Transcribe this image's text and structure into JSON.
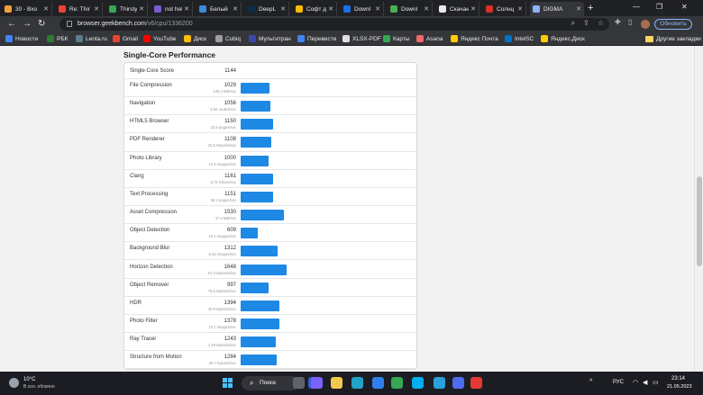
{
  "browser": {
    "tabs": [
      {
        "title": "30 - Вхо",
        "color": "#f2a03d"
      },
      {
        "title": "Re: Thir",
        "color": "#ea4335"
      },
      {
        "title": "Thirsty",
        "color": "#34a853"
      },
      {
        "title": "not hel",
        "color": "#7b5cd6"
      },
      {
        "title": "Белый",
        "color": "#3d8ad8"
      },
      {
        "title": "DeepL",
        "color": "#0f2b46"
      },
      {
        "title": "Софт д",
        "color": "#fbbc04"
      },
      {
        "title": "Downl",
        "color": "#1a73e8"
      },
      {
        "title": "Downl",
        "color": "#4caf50"
      },
      {
        "title": "Скачан",
        "color": "#e8eaed"
      },
      {
        "title": "Солнц",
        "color": "#d93025"
      },
      {
        "title": "DIGMA",
        "color": "#8ab4f8"
      }
    ],
    "url_host": "browser.geekbench.com",
    "url_path": "/v6/cpu/1336200",
    "update_label": "Обновить"
  },
  "bookmarks": [
    {
      "label": "Новости",
      "color": "#4285f4"
    },
    {
      "label": "РБК",
      "color": "#2e7d32"
    },
    {
      "label": "Lenta.ru",
      "color": "#607d8b"
    },
    {
      "label": "Gmail",
      "color": "#ea4335"
    },
    {
      "label": "YouTube",
      "color": "#ff0000"
    },
    {
      "label": "Диск",
      "color": "#fbbc04"
    },
    {
      "label": "Cubiq",
      "color": "#9e9e9e"
    },
    {
      "label": "Мультитран",
      "color": "#3949ab"
    },
    {
      "label": "Перевести",
      "color": "#4285f4"
    },
    {
      "label": "XLSX-PDF",
      "color": "#e0e0e0"
    },
    {
      "label": "Карты",
      "color": "#34a853"
    },
    {
      "label": "Asana",
      "color": "#f06a6a"
    },
    {
      "label": "Яндекс Почта",
      "color": "#ffcc00"
    },
    {
      "label": "IntelSC",
      "color": "#0071c5"
    },
    {
      "label": "Яндекс.Диск",
      "color": "#ffcc00"
    }
  ],
  "other_bookmarks_label": "Другие закладки",
  "section_title": "Single-Core Performance",
  "total": {
    "name": "Single-Core Score",
    "score": "1144"
  },
  "max_score": 1800,
  "benchmarks": [
    {
      "name": "File Compression",
      "score": "1029",
      "rate": "149.2 MB/sec"
    },
    {
      "name": "Navigation",
      "score": "1056",
      "rate": "6.82 routes/sec"
    },
    {
      "name": "HTML5 Browser",
      "score": "1150",
      "rate": "23.5 pages/sec"
    },
    {
      "name": "PDF Renderer",
      "score": "1108",
      "rate": "25.5 Mpixels/sec"
    },
    {
      "name": "Photo Library",
      "score": "1000",
      "rate": "13.6 images/sec"
    },
    {
      "name": "Clang",
      "score": "1161",
      "rate": "5.72 Klines/sec"
    },
    {
      "name": "Text Processing",
      "score": "1151",
      "rate": "58.2 pages/sec"
    },
    {
      "name": "Asset Compression",
      "score": "1530",
      "rate": "47.4 MB/sec"
    },
    {
      "name": "Object Detection",
      "score": "609",
      "rate": "18.2 images/sec"
    },
    {
      "name": "Background Blur",
      "score": "1312",
      "rate": "5.43 images/sec"
    },
    {
      "name": "Horizon Detection",
      "score": "1648",
      "rate": "51.3 Mpixels/sec"
    },
    {
      "name": "Object Remover",
      "score": "997",
      "rate": "76.6 Mpixels/sec"
    },
    {
      "name": "HDR",
      "score": "1394",
      "rate": "40.9 Mpixels/sec"
    },
    {
      "name": "Photo Filter",
      "score": "1378",
      "rate": "13.7 images/sec"
    },
    {
      "name": "Ray Tracer",
      "score": "1243",
      "rate": "1.29 Mpixels/sec"
    },
    {
      "name": "Structure from Motion",
      "score": "1284",
      "rate": "40.7 Kpixels/sec"
    }
  ],
  "colors": {
    "bar": "#1e88e5"
  },
  "taskbar": {
    "weather_temp": "10°C",
    "weather_desc": "В осн. облачно",
    "search_label": "Поиск",
    "lang": "РУС",
    "time": "23:14",
    "date": "21.05.2023",
    "apps": [
      {
        "name": "task-view-icon",
        "color": "#5f6368"
      },
      {
        "name": "widgets-icon",
        "color": "#3b5bdb"
      },
      {
        "name": "chat-icon",
        "color": "#7b61ff"
      },
      {
        "name": "explorer-icon",
        "color": "#f2c94c"
      },
      {
        "name": "edge-icon",
        "color": "#22a4c9"
      },
      {
        "name": "store-icon",
        "color": "#2f80ed"
      },
      {
        "name": "chrome-icon",
        "color": "#34a853"
      },
      {
        "name": "skype-icon",
        "color": "#00aff0"
      },
      {
        "name": "telegram-icon",
        "color": "#2aa1da"
      },
      {
        "name": "kanban-icon",
        "color": "#4f6bed"
      },
      {
        "name": "music-icon",
        "color": "#e53935"
      }
    ]
  }
}
